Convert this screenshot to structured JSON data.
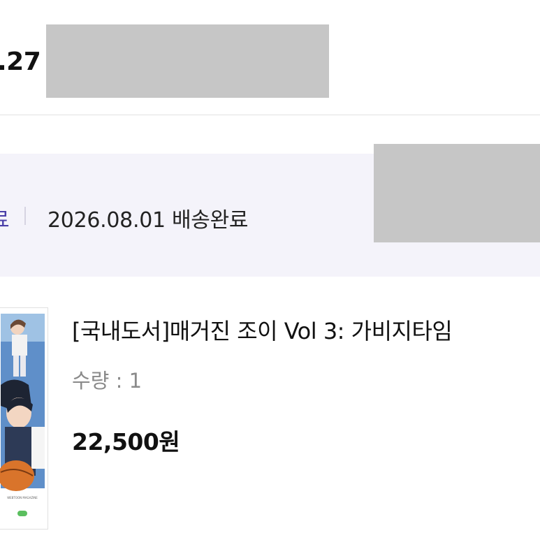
{
  "order": {
    "date_fragment": ".27"
  },
  "delivery": {
    "status_label": "료",
    "status_text": "2026.08.01 배송완료"
  },
  "product": {
    "title": "[국내도서]매거진 조이 Vol 3: 가비지타임",
    "quantity_text": "수량 : 1",
    "price_text": "22,500원",
    "cover_small_text": "WEBTOON MAGAZINE"
  },
  "colors": {
    "status_bg": "#f4f3fa",
    "status_accent": "#4a3fa8",
    "redaction": "#c6c6c6"
  }
}
